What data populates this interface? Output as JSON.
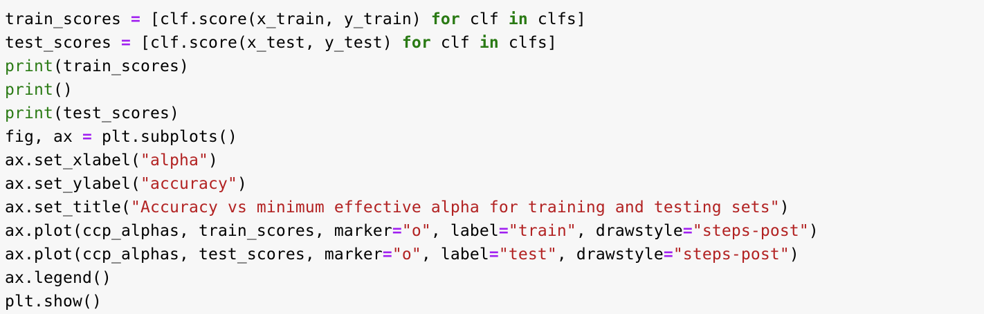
{
  "code_cell": {
    "lines": [
      [
        {
          "t": "train_scores ",
          "k": "plain"
        },
        {
          "t": "=",
          "k": "op"
        },
        {
          "t": " [clf.score(x_train, y_train) ",
          "k": "plain"
        },
        {
          "t": "for",
          "k": "kw"
        },
        {
          "t": " clf ",
          "k": "plain"
        },
        {
          "t": "in",
          "k": "kw"
        },
        {
          "t": " clfs]",
          "k": "plain"
        }
      ],
      [
        {
          "t": "test_scores ",
          "k": "plain"
        },
        {
          "t": "=",
          "k": "op"
        },
        {
          "t": " [clf.score(x_test, y_test) ",
          "k": "plain"
        },
        {
          "t": "for",
          "k": "kw"
        },
        {
          "t": " clf ",
          "k": "plain"
        },
        {
          "t": "in",
          "k": "kw"
        },
        {
          "t": " clfs]",
          "k": "plain"
        }
      ],
      [
        {
          "t": "print",
          "k": "builtin"
        },
        {
          "t": "(train_scores)",
          "k": "plain"
        }
      ],
      [
        {
          "t": "print",
          "k": "builtin"
        },
        {
          "t": "()",
          "k": "plain"
        }
      ],
      [
        {
          "t": "print",
          "k": "builtin"
        },
        {
          "t": "(test_scores)",
          "k": "plain"
        }
      ],
      [
        {
          "t": "fig, ax ",
          "k": "plain"
        },
        {
          "t": "=",
          "k": "op"
        },
        {
          "t": " plt.subplots()",
          "k": "plain"
        }
      ],
      [
        {
          "t": "ax.set_xlabel(",
          "k": "plain"
        },
        {
          "t": "\"alpha\"",
          "k": "str"
        },
        {
          "t": ")",
          "k": "plain"
        }
      ],
      [
        {
          "t": "ax.set_ylabel(",
          "k": "plain"
        },
        {
          "t": "\"accuracy\"",
          "k": "str"
        },
        {
          "t": ")",
          "k": "plain"
        }
      ],
      [
        {
          "t": "ax.set_title(",
          "k": "plain"
        },
        {
          "t": "\"Accuracy vs minimum effective alpha for training and testing sets\"",
          "k": "str"
        },
        {
          "t": ")",
          "k": "plain"
        }
      ],
      [
        {
          "t": "ax.plot(ccp_alphas, train_scores, marker",
          "k": "plain"
        },
        {
          "t": "=",
          "k": "op"
        },
        {
          "t": "\"o\"",
          "k": "str"
        },
        {
          "t": ", label",
          "k": "plain"
        },
        {
          "t": "=",
          "k": "op"
        },
        {
          "t": "\"train\"",
          "k": "str"
        },
        {
          "t": ", drawstyle",
          "k": "plain"
        },
        {
          "t": "=",
          "k": "op"
        },
        {
          "t": "\"steps-post\"",
          "k": "str"
        },
        {
          "t": ")",
          "k": "plain"
        }
      ],
      [
        {
          "t": "ax.plot(ccp_alphas, test_scores, marker",
          "k": "plain"
        },
        {
          "t": "=",
          "k": "op"
        },
        {
          "t": "\"o\"",
          "k": "str"
        },
        {
          "t": ", label",
          "k": "plain"
        },
        {
          "t": "=",
          "k": "op"
        },
        {
          "t": "\"test\"",
          "k": "str"
        },
        {
          "t": ", drawstyle",
          "k": "plain"
        },
        {
          "t": "=",
          "k": "op"
        },
        {
          "t": "\"steps-post\"",
          "k": "str"
        },
        {
          "t": ")",
          "k": "plain"
        }
      ],
      [
        {
          "t": "ax.legend()",
          "k": "plain"
        }
      ],
      [
        {
          "t": "plt.show()",
          "k": "plain"
        }
      ]
    ],
    "colors": {
      "background": "#f7f7f7",
      "text": "#000000",
      "keyword": "#2a7a14",
      "builtin": "#2a7a14",
      "operator": "#a020f0",
      "string": "#b22222"
    }
  }
}
